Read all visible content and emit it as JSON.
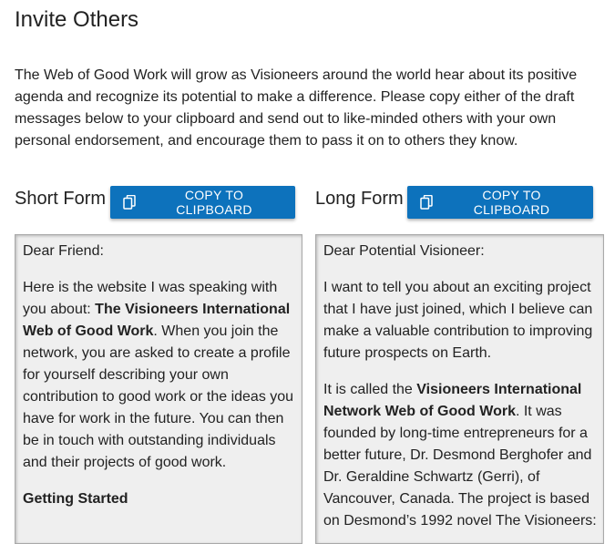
{
  "page": {
    "title": "Invite Others",
    "intro": "The Web of Good Work will grow as Visioneers around the world hear about its positive agenda and recognize its potential to make a difference.  Please copy either of the draft messages below to your clipboard and send out to like-minded others with your own personal endorsement, and encourage them to pass it on to others they know."
  },
  "short_form": {
    "title": "Short Form",
    "copy_label": "COPY TO CLIPBOARD",
    "greeting": "Dear Friend:",
    "p1_lead": "Here is the website I was speaking with you about: ",
    "p1_bold": "The Visioneers International Web of Good Work",
    "p1_tail": ". When you join the network, you are asked to create a profile for yourself describing your own contribution to good work or the ideas you have for work in the future. You can then be in touch with outstanding individuals and their projects of good work.",
    "heading": "Getting Started"
  },
  "long_form": {
    "title": "Long Form",
    "copy_label": "COPY TO CLIPBOARD",
    "greeting": "Dear Potential Visioneer:",
    "p1": "I want to tell you about an exciting project that I have just joined, which I believe can make a valuable contribution to improving future prospects on Earth.",
    "p2_lead": "It is called the ",
    "p2_bold": "Visioneers International Network Web of Good Work",
    "p2_tail": ". It was founded by long-time entrepreneurs for a better future, Dr. Desmond Berghofer and Dr. Geraldine Schwartz (Gerri), of Vancouver, Canada. The project is based on Desmond’s 1992 novel The Visioneers:"
  },
  "icons": {
    "copy": "copy-icon"
  },
  "colors": {
    "button_bg": "#0d72bc",
    "box_bg": "#efefef"
  }
}
